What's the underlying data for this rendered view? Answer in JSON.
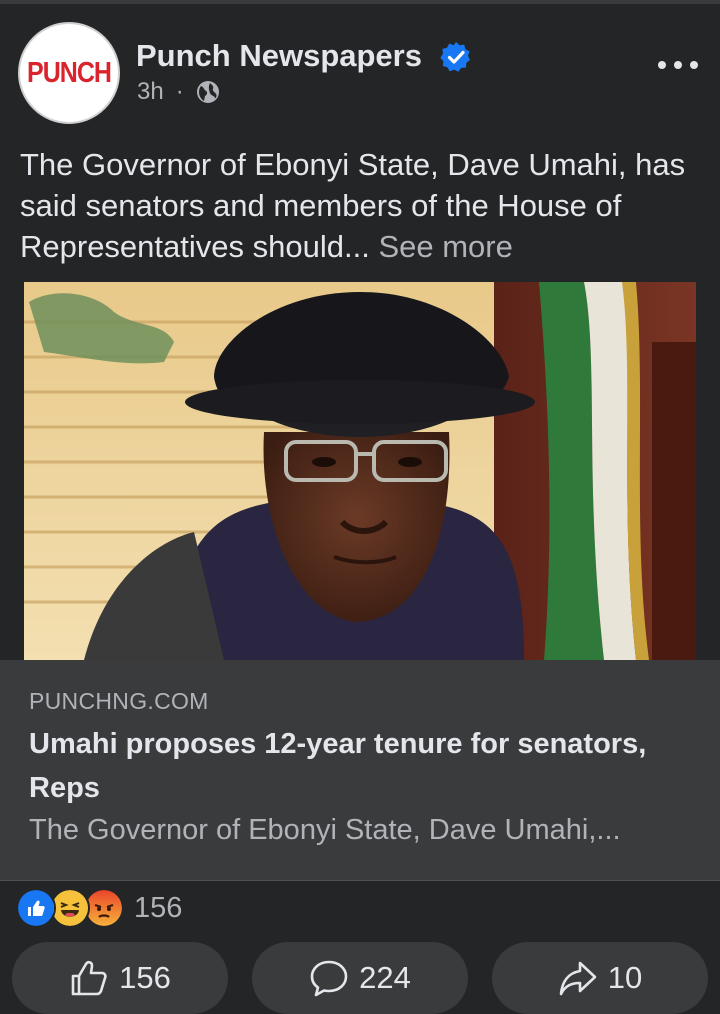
{
  "post": {
    "page_name": "Punch Newspapers",
    "avatar_text": "PUNCH",
    "time": "3h",
    "separator": "·",
    "text": "The Governor of Ebonyi State, Dave Umahi, has said senators and members of the House of Representatives should...",
    "see_more": "See more"
  },
  "link": {
    "domain": "PUNCHNG.COM",
    "title": "Umahi proposes 12-year tenure for senators, Reps",
    "description": "The Governor of Ebonyi State, Dave Umahi,..."
  },
  "reactions": {
    "icons": [
      "like-reaction",
      "haha-reaction",
      "angry-reaction"
    ],
    "count": "156"
  },
  "actions": {
    "like_count": "156",
    "comment_count": "224",
    "share_count": "10"
  },
  "colors": {
    "background": "#242526",
    "card": "#3a3b3c",
    "verified": "#1877f2",
    "brand_red": "#d9232d"
  }
}
